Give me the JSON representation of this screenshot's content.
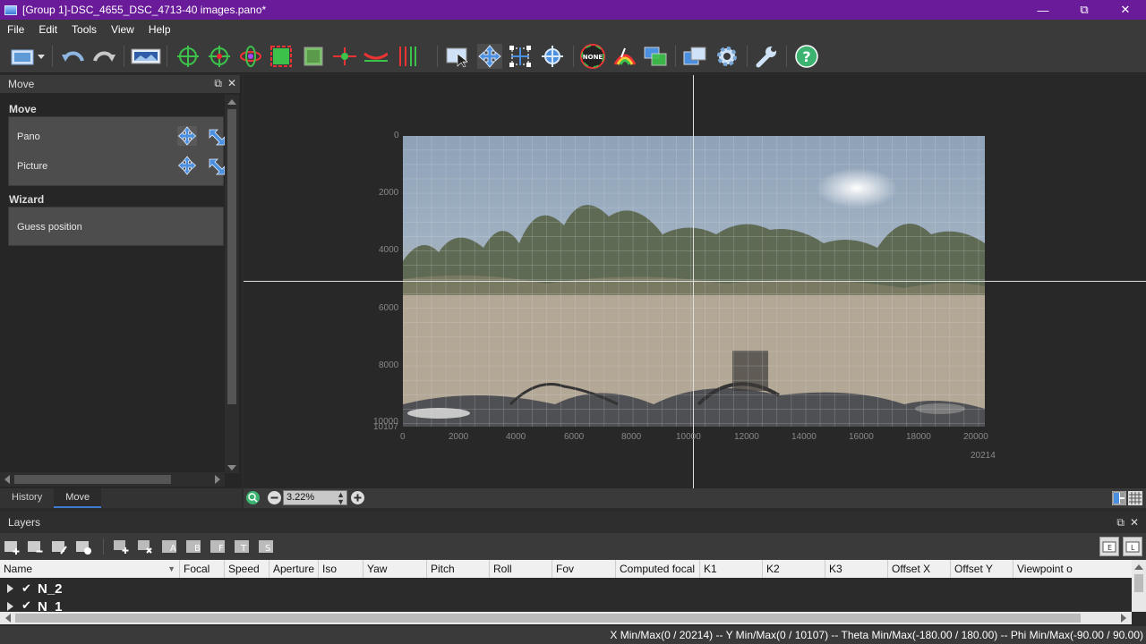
{
  "window": {
    "title": "[Group 1]-DSC_4655_DSC_4713-40 images.pano*",
    "minimize_glyph": "—",
    "maximize_glyph": "⧉",
    "close_glyph": "✕"
  },
  "menu": {
    "items": [
      "File",
      "Edit",
      "Tools",
      "View",
      "Help"
    ]
  },
  "toolbar": {
    "icons": [
      "open-project-icon",
      "undo-icon",
      "redo-icon",
      "panorama-icon",
      "control-points-icon",
      "add-control-point-icon",
      "optimize-icon",
      "crop-icon",
      "mask-icon",
      "horizon-icon",
      "straighten-icon",
      "vertical-lines-icon",
      "select-icon",
      "move-icon",
      "transform-icon",
      "target-icon",
      "color-none-icon",
      "color-balance-icon",
      "blend-icon",
      "render-icon",
      "settings-icon",
      "tools-icon",
      "help-icon"
    ],
    "none_label": "NONE"
  },
  "move_panel": {
    "header": "Move",
    "section_move": "Move",
    "pano_label": "Pano",
    "picture_label": "Picture",
    "section_wizard": "Wizard",
    "guess_label": "Guess position"
  },
  "left_tabs": {
    "history": "History",
    "move": "Move"
  },
  "viewport": {
    "y_ticks": [
      "0",
      "2000",
      "4000",
      "6000",
      "8000",
      "10000"
    ],
    "y_max_label": "10107",
    "x_ticks": [
      "0",
      "2000",
      "4000",
      "6000",
      "8000",
      "10000",
      "12000",
      "14000",
      "16000",
      "18000",
      "20000"
    ],
    "x_max_label": "20214",
    "zoom_value": "3.22%"
  },
  "layers": {
    "title": "Layers",
    "columns": [
      "Name",
      "Focal",
      "Speed",
      "Aperture",
      "Iso",
      "Yaw",
      "Pitch",
      "Roll",
      "Fov",
      "Computed focal",
      "K1",
      "K2",
      "K3",
      "Offset X",
      "Offset Y",
      "Viewpoint o"
    ],
    "rows": [
      {
        "name": "N_2",
        "checked": "✔"
      },
      {
        "name": "N_1",
        "checked": "✔"
      }
    ]
  },
  "status": {
    "text": "X Min/Max(0 / 20214)   --  Y Min/Max(0 / 10107)   --   Theta Min/Max(-180.00 / 180.00)   --   Phi Min/Max(-90.00 / 90.00)"
  }
}
